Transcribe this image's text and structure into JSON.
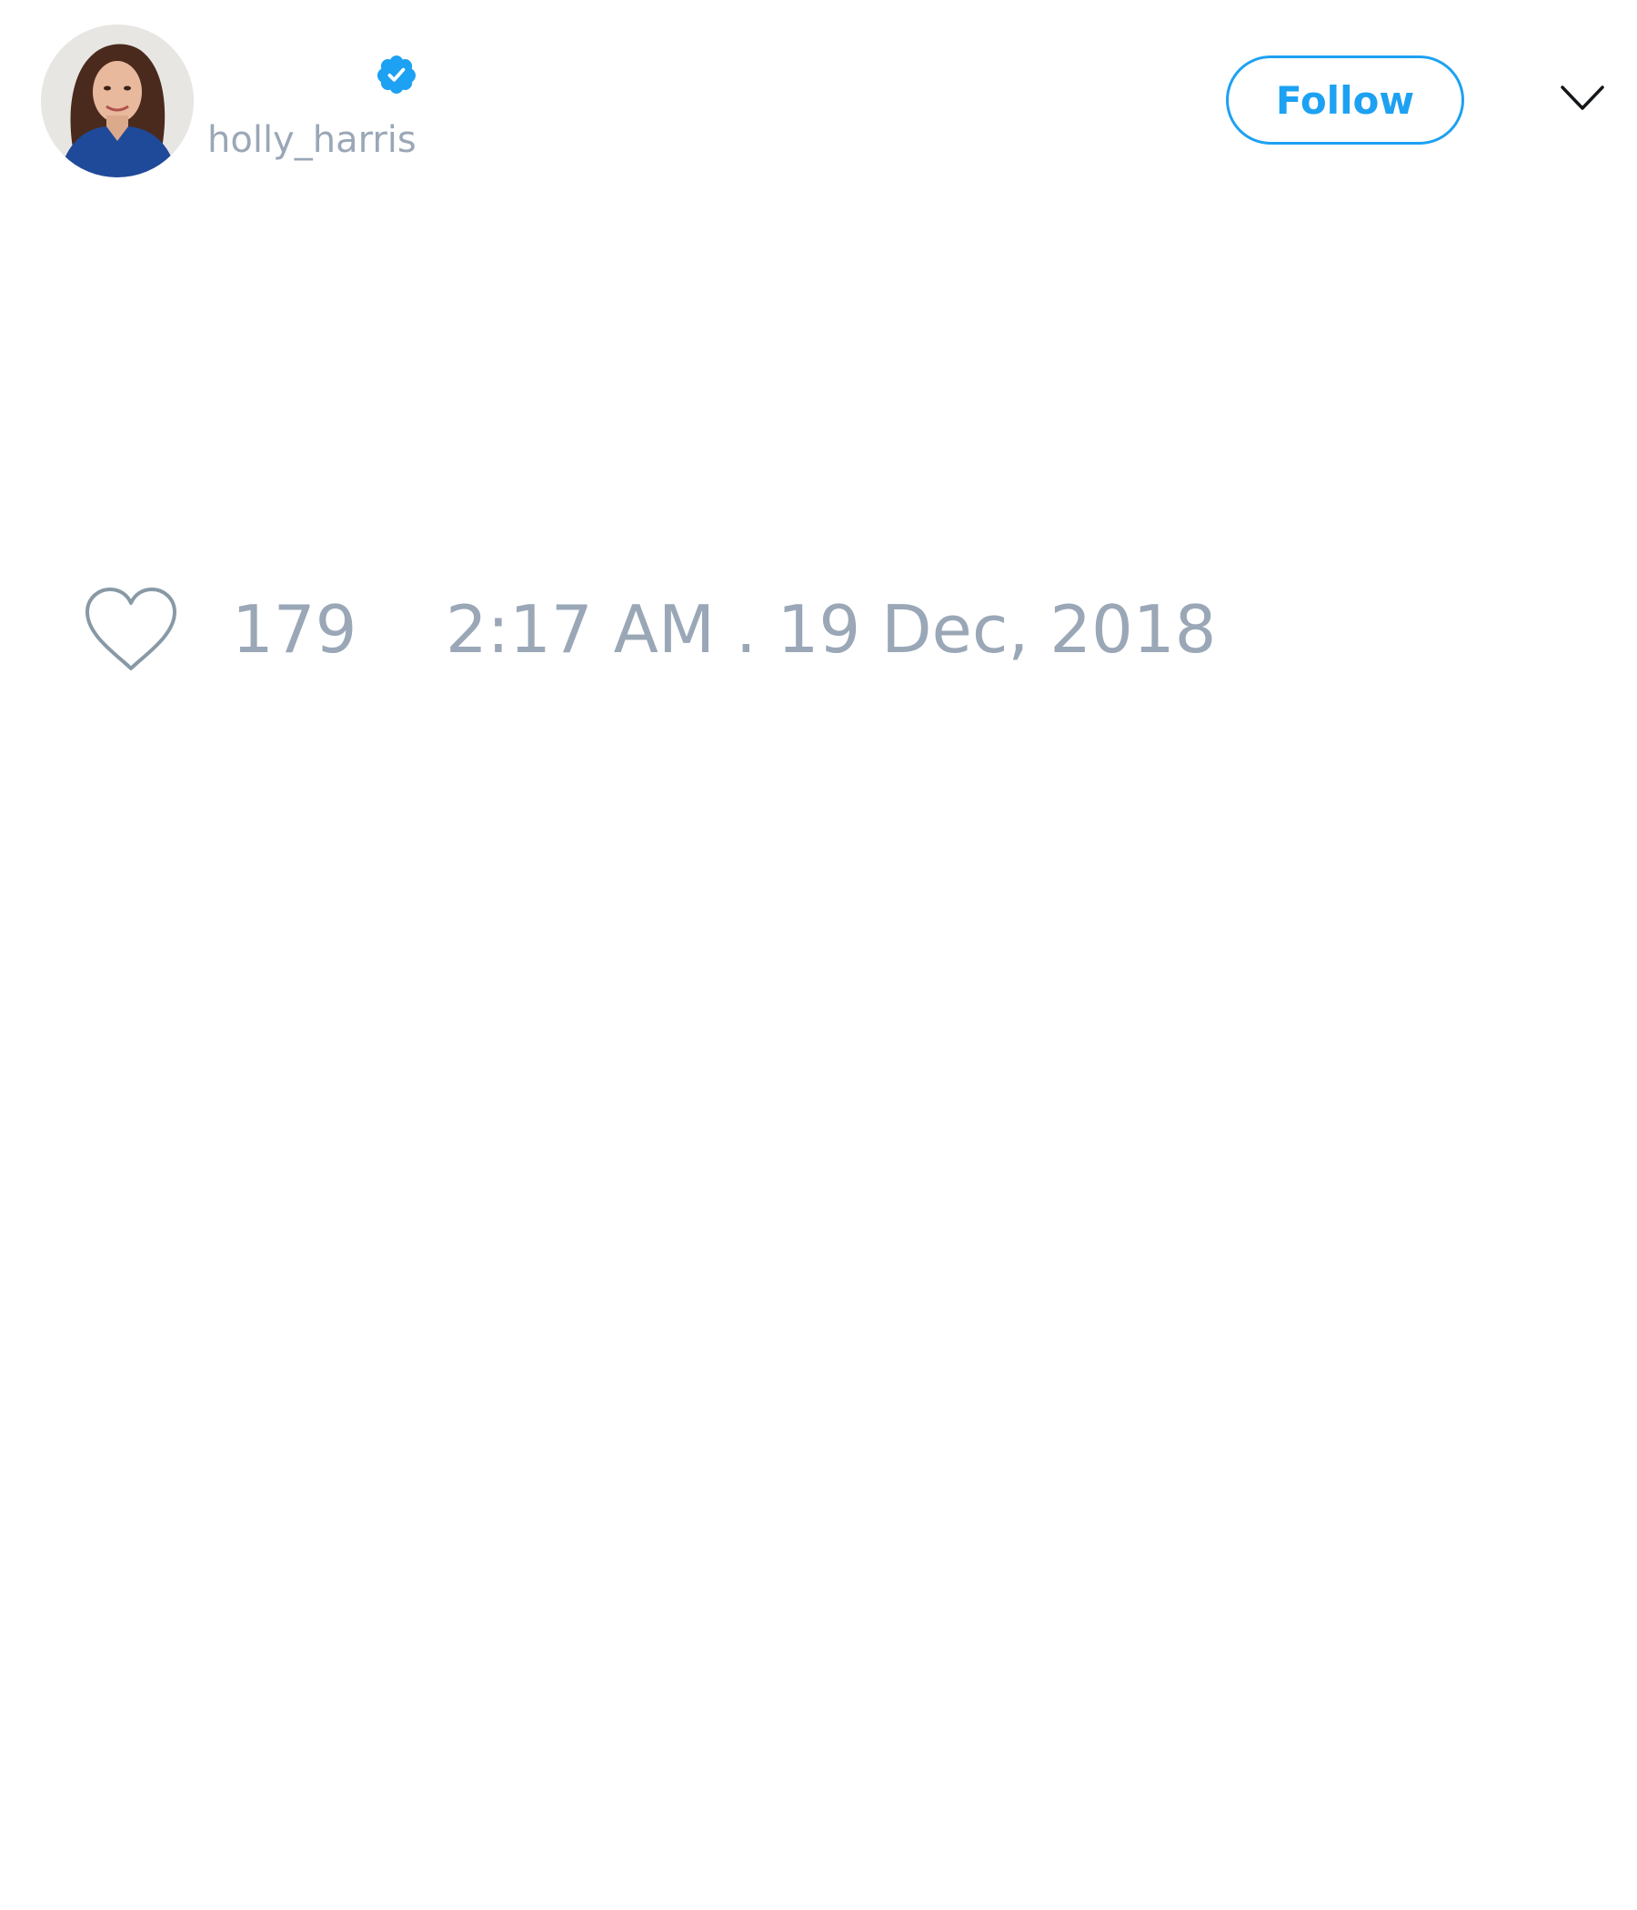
{
  "tweet": {
    "author": {
      "handle": "holly_harris",
      "verified": true,
      "avatar_icon": "profile-photo"
    },
    "follow_label": "Follow",
    "likes_count": "179",
    "timestamp": "2:17 AM . 19 Dec, 2018"
  },
  "icons": {
    "verified": "verified-badge-icon",
    "menu": "chevron-down-icon",
    "like": "heart-icon"
  },
  "colors": {
    "accent": "#1da1f2",
    "muted_text": "#9aa7b7",
    "icon_stroke": "#8899a6",
    "background": "#ffffff"
  }
}
